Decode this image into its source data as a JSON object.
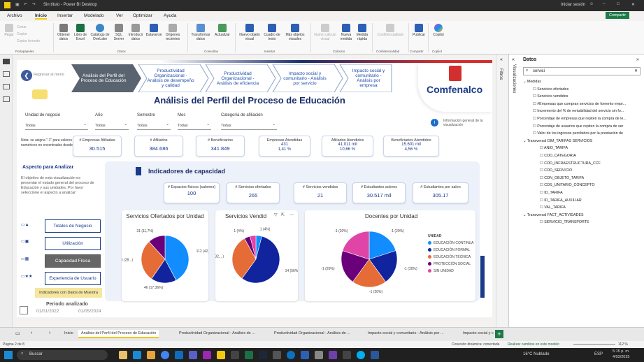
{
  "window": {
    "title": "Sin título - Power BI Desktop",
    "login": "Iniciar sesión",
    "share": "Compartir"
  },
  "menu": [
    "Archivo",
    "Inicio",
    "Insertar",
    "Modelado",
    "Ver",
    "Optimizar",
    "Ayuda"
  ],
  "ribbon": {
    "clipboard": [
      "Pegar",
      "Cortar",
      "Copiar",
      "Copiar formato"
    ],
    "buttons": [
      "Obtener datos",
      "Libro de Excel",
      "Catálogo de OneLake",
      "SQL Server",
      "Introducir datos",
      "Dataverse",
      "Orígenes recientes",
      "Transformar datos",
      "Actualizar",
      "Nuevo objeto visual",
      "Cuadro de texto",
      "Más objetos visuales",
      "Nueva medida",
      "Medida rápida",
      "Confidencialidad",
      "Publicar",
      "Copilot"
    ],
    "disabled": "Nuevo cálculo visual",
    "groups": [
      "Portapapeles",
      "Datos",
      "Consultas",
      "Insertar",
      "Cálculos",
      "Confidencialidad",
      "Compartir",
      "Copilot"
    ]
  },
  "report": {
    "back": "Regresar al menú",
    "nav_steps": [
      "Análisis del Perfil del Proceso de Educación",
      "Productividad Organizacional - Análisis de desempeño y calidad",
      "Productividad Organizacional - Análisis de eficiencia",
      "Impacto social y comunitario - Análisis por servicio",
      "Impacto social y comunitario - Análisis por empresa"
    ],
    "title": "Análisis del Perfil del Proceso de Educación",
    "logo": "Comfenalco",
    "info_text": "Información general de la visualización",
    "filters": [
      {
        "label": "Unidad de negocio",
        "value": "Todas"
      },
      {
        "label": "Año",
        "value": "Todas"
      },
      {
        "label": "Semestre",
        "value": "Todas"
      },
      {
        "label": "Mes",
        "value": "Todas"
      },
      {
        "label": "Categoría de afiliación",
        "value": "Todas"
      }
    ],
    "note": "Nota: se asigna \"-1\" para valores numéricos no encontrados desde",
    "kpis": [
      {
        "label": "# Empresas Afiliadas",
        "value": "30.515"
      },
      {
        "label": "# Afiliados",
        "value": "384.686"
      },
      {
        "label": "# Beneficiarios",
        "value": "341.849"
      },
      {
        "label": "Empresas Atendidas",
        "value": "431",
        "pct": "1,41 %"
      },
      {
        "label": "Afiliados Atendidos",
        "value": "41.011 mil",
        "pct": "10,66 %"
      },
      {
        "label": "Beneficiarios Atendidos",
        "value": "15.601 mil",
        "pct": "4,56 %"
      }
    ],
    "aspect_title": "Aspecto para Analizar",
    "aspect_text": "El objetivo de esta visualización es presentar el estado general del proceso de Educación y sus unidades. Por favor seleccione el aspecto a analizar:",
    "aspect_buttons": [
      "Totales de Negocio",
      "Utilización",
      "Capacidad Física",
      "Experiencia de Usuario"
    ],
    "indicators_label": "Indicadores con Datos de Muestra",
    "period": {
      "label": "Periodo analizado",
      "from": "01/01/2022",
      "to": "01/05/2024"
    },
    "capacity": {
      "title": "Indicadores de capacidad",
      "kpis": [
        {
          "label": "# Espacios físicos (salones)",
          "value": "100"
        },
        {
          "label": "# Servicios ofertados",
          "value": "265"
        },
        {
          "label": "# Servicios vendidos",
          "value": "21"
        },
        {
          "label": "# Estudiantes activos",
          "value": "30.517 mil"
        },
        {
          "label": "# Estudiantes por salon",
          "value": "305.17"
        }
      ]
    },
    "pies_titles": [
      "Servicios Ofertados por Unidad",
      "Servicios Vendid",
      "Docentes por Unidad"
    ],
    "legend_title": "UNIDAD"
  },
  "colors": {
    "c1": "#118dff",
    "c2": "#12239e",
    "c3": "#e66c37",
    "c4": "#6b007b",
    "c5": "#e044a7"
  },
  "chart_data": [
    {
      "type": "pie",
      "title": "Servicios Ofertados por Unidad",
      "slices": [
        {
          "value": 112,
          "label": "112 (42,26%)",
          "color": "#118dff"
        },
        {
          "value": 46,
          "label": "46 (17,36%)",
          "color": "#12239e"
        },
        {
          "value": 76,
          "label": "76 (28...)",
          "color": "#e66c37"
        },
        {
          "value": 31,
          "label": "31 (11,7%)",
          "color": "#6b007b"
        }
      ]
    },
    {
      "type": "pie",
      "title": "Servicios Vendid",
      "slices": [
        {
          "value": 1,
          "label": "1 (4%)",
          "color": "#118dff"
        },
        {
          "value": 14,
          "label": "14 (56%)",
          "color": "#12239e"
        },
        {
          "value": 8,
          "label": "8 (32,...)",
          "color": "#e66c37"
        },
        {
          "value": 1,
          "label": "1 (4%)",
          "color": "#6b007b"
        },
        {
          "value": 1,
          "label": "",
          "color": "#e044a7"
        }
      ]
    },
    {
      "type": "pie",
      "title": "Docentes por Unidad",
      "slices": [
        {
          "value": 1,
          "label": "-1 (20%)",
          "color": "#118dff"
        },
        {
          "value": 1,
          "label": "-1 (20%)",
          "color": "#12239e"
        },
        {
          "value": 1,
          "label": "-1 (20%)",
          "color": "#e66c37"
        },
        {
          "value": 1,
          "label": "-1 (20%)",
          "color": "#6b007b"
        },
        {
          "value": 1,
          "label": "-1 (20%)",
          "color": "#e044a7"
        }
      ],
      "legend": [
        "EDUCACIÓN CONTINUA",
        "EDUCACIÓN FORMAL",
        "EDUCACIÓN TÉCNICA",
        "PROTECCIÓN SOCIAL",
        "SIN UNIDAD"
      ]
    }
  ],
  "panes": {
    "filters": "Filtros",
    "visualizations": "Visualizaciones",
    "data": "Datos",
    "search": "servici"
  },
  "tree": [
    {
      "text": "Medidas",
      "level": 0
    },
    {
      "text": "Servicios ofertados",
      "level": 1
    },
    {
      "text": "Servicios vendidos",
      "level": 1
    },
    {
      "text": "#Empresas que compran servicios de fomento empr...",
      "level": 1
    },
    {
      "text": "Incremento del % de rentabilidad del servicio sin fo...",
      "level": 1
    },
    {
      "text": "Porcentaje de empresas que repiten la compra de le...",
      "level": 1
    },
    {
      "text": "Porcentaje de usuarios que repiten la compra de ser",
      "level": 1
    },
    {
      "text": "Valor de los ingresos percibidos por la prestación de",
      "level": 1
    },
    {
      "text": "Transversal DIM_TARIFAS SERVICIOS",
      "level": 0
    },
    {
      "text": "ANIO_TARIFA",
      "level": 2
    },
    {
      "text": "COD_CATEGORIA",
      "level": 2
    },
    {
      "text": "COD_INFRAESTRUCTURA_CCF",
      "level": 2
    },
    {
      "text": "COD_SERVICIO",
      "level": 2
    },
    {
      "text": "CON_OBJETO_TARIFA",
      "level": 2
    },
    {
      "text": "COS_UNITARIO_CONCEPTO",
      "level": 2
    },
    {
      "text": "ID_TARIFA",
      "level": 2
    },
    {
      "text": "ID_TARIFA_AUXILIAR",
      "level": 2
    },
    {
      "text": "VAL_TARIFA",
      "level": 2
    },
    {
      "text": "Transversal FACT_ACTIVIDADES",
      "level": 0
    },
    {
      "text": "SERVICIO_TRANSPORTE",
      "level": 2
    }
  ],
  "tabs": [
    "Inicio",
    "Análisis del Perfil del Proceso de Educación",
    "Productividad Organizacional - Análisis de ...",
    "Productividad Organizacional - Análisis de ...",
    "Impacto social y comunitario - Análisis por ...",
    "Impacto social y c"
  ],
  "status": {
    "page": "Página 2 de 8",
    "conn": "Conexión dinámica: conectada",
    "changes": "Realizar cambios en este modelo",
    "zoom": "112 %"
  },
  "taskbar": {
    "search": "Buscar",
    "weather": "16°C Nublado",
    "lang": "ESP",
    "time": "5:15 p. m.",
    "date": "4/03/2025"
  }
}
